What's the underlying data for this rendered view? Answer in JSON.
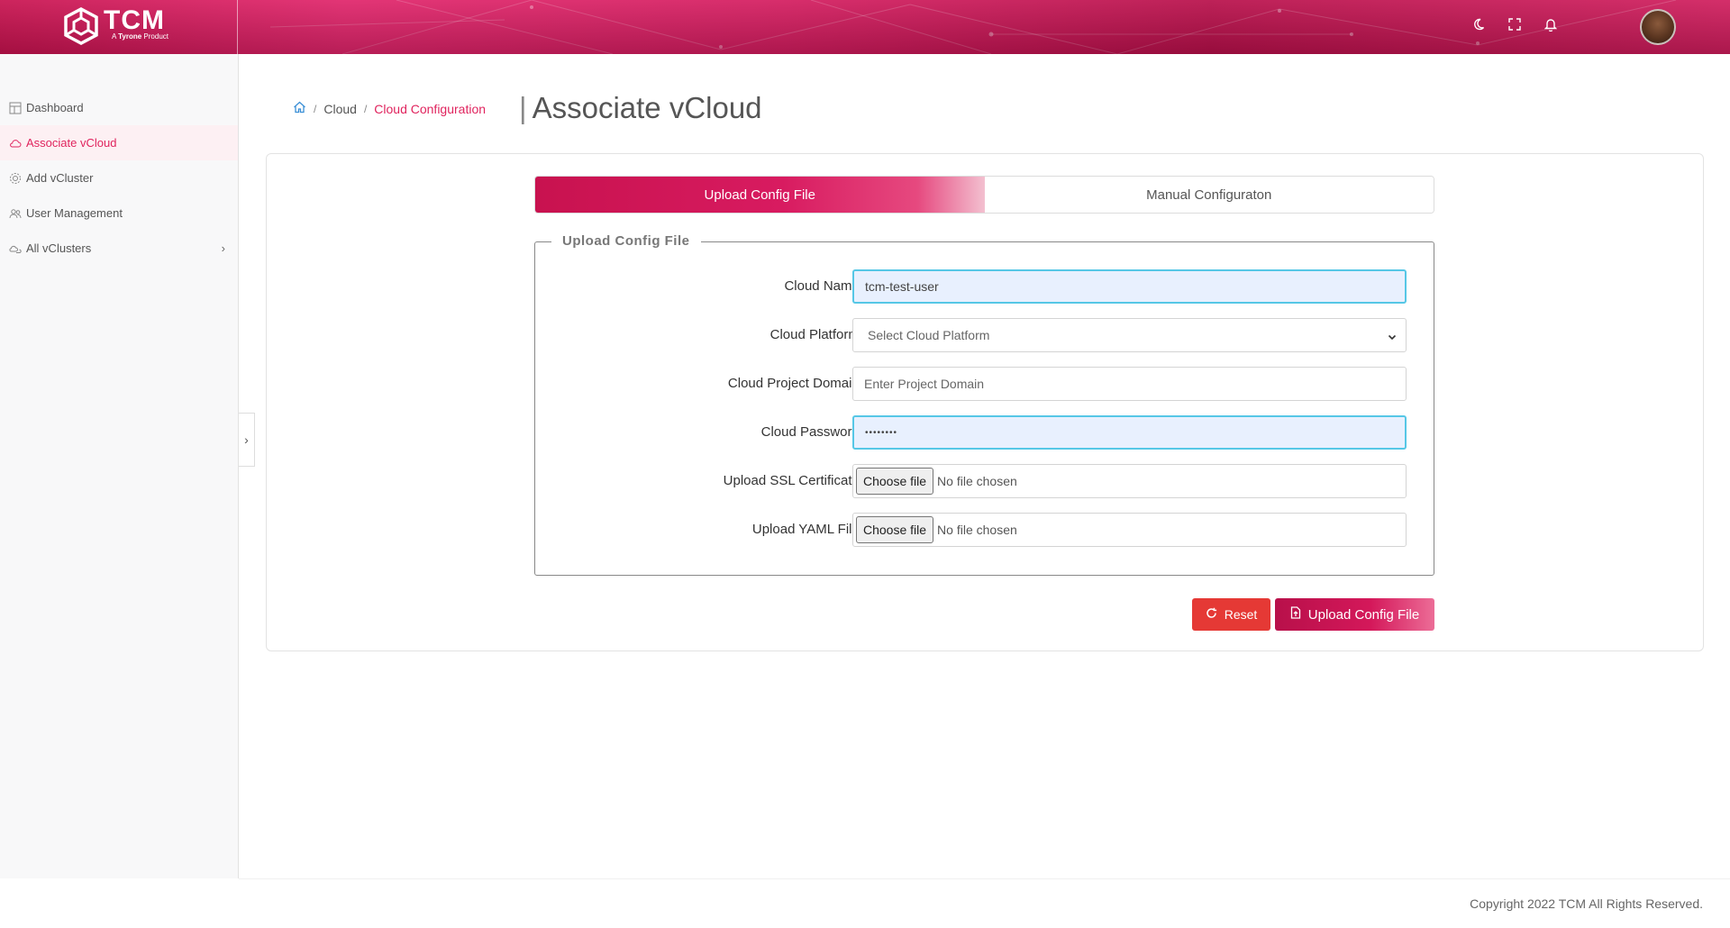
{
  "brand": {
    "name": "TCM",
    "tagline_prefix": "A ",
    "tagline_brand": "Tyrone",
    "tagline_suffix": " Product"
  },
  "header": {
    "icons": [
      "theme-moon-icon",
      "fullscreen-icon",
      "bell-icon"
    ],
    "avatar": "user-avatar"
  },
  "sidebar": {
    "items": [
      {
        "label": "Dashboard",
        "icon": "dashboard-icon"
      },
      {
        "label": "Associate vCloud",
        "icon": "cloud-icon"
      },
      {
        "label": "Add vCluster",
        "icon": "cluster-icon"
      },
      {
        "label": "User Management",
        "icon": "users-icon"
      },
      {
        "label": "All vClusters",
        "icon": "clusters-icon"
      }
    ],
    "active_index": 1
  },
  "breadcrumb": {
    "items": [
      "Cloud",
      "Cloud Configuration"
    ],
    "separator": "/"
  },
  "page": {
    "title": "Associate vCloud"
  },
  "tabs": [
    {
      "label": "Upload Config File",
      "active": true
    },
    {
      "label": "Manual Configuraton",
      "active": false
    }
  ],
  "form": {
    "legend": "Upload Config File",
    "cloud_name": {
      "label": "Cloud Name:",
      "value": "tcm-test-user"
    },
    "cloud_platform": {
      "label": "Cloud Platform:",
      "selected": "Select Cloud Platform"
    },
    "project_domain": {
      "label": "Cloud Project Domain:",
      "placeholder": "Enter Project Domain"
    },
    "password": {
      "label": "Cloud Password:",
      "value": "••••••••"
    },
    "ssl_cert": {
      "label": "Upload SSL Certificate:",
      "button": "Choose file",
      "status": "No file chosen"
    },
    "yaml_file": {
      "label": "Upload YAML File:",
      "button": "Choose file",
      "status": "No file chosen"
    }
  },
  "actions": {
    "reset": "Reset",
    "upload": "Upload Config File"
  },
  "footer": {
    "copyright": "Copyright 2022 TCM All Rights Reserved."
  },
  "colors": {
    "accent": "#e0245e",
    "header": "#c8124f",
    "reset": "#e53935",
    "focus": "#56c7e6"
  }
}
